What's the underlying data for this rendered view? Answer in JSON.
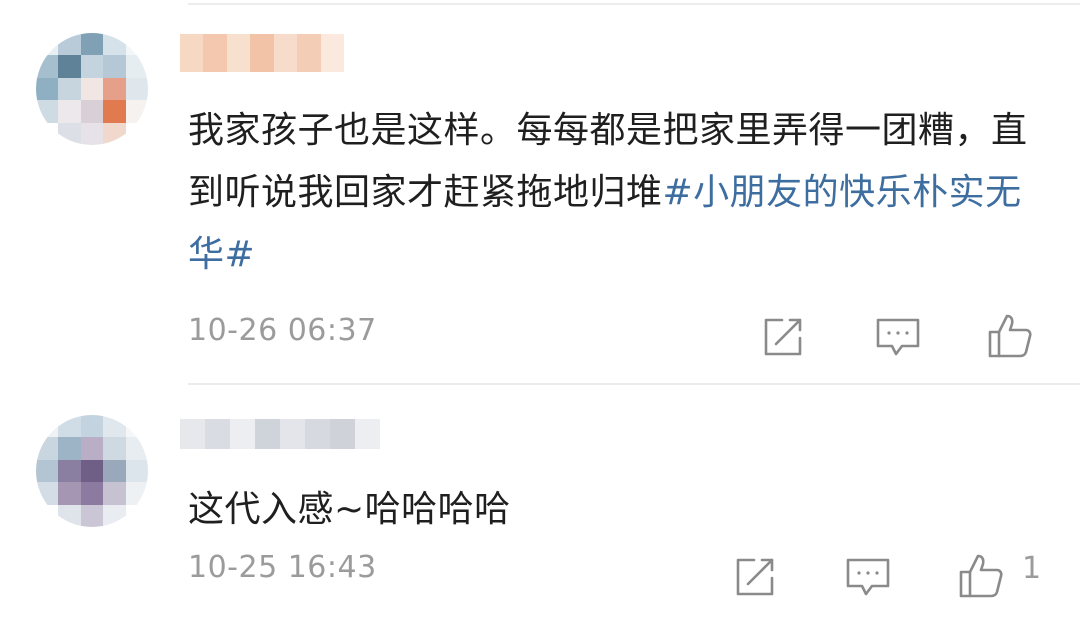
{
  "comments": [
    {
      "text_plain": "我家孩子也是这样。每每都是把家里弄得一团糟，直到听说我回家才赶紧拖地归堆",
      "topic": "#小朋友的快乐朴实无华#",
      "time": "10-26 06:37",
      "avatar_colors": [
        "#e9f0f4",
        "#b9cbd8",
        "#7fa0b5",
        "#d5e2ea",
        "#f3f6f8",
        "#a6bfcf",
        "#5f8299",
        "#c4d4de",
        "#b4c8d5",
        "#e6edf1",
        "#8fb0c3",
        "#c7d5de",
        "#f1e6e3",
        "#e6a08a",
        "#dfe7ec",
        "#cfdbe3",
        "#ece8ec",
        "#d9cfd6",
        "#e27a50",
        "#f5f2f0",
        "#ffffff",
        "#dcdfe6",
        "#e7e2e7",
        "#f1d8cd",
        "#ffffff"
      ],
      "username_colors": [
        "#f7d8c3",
        "#f3c8ae",
        "#f8e0cf",
        "#f2c3a6",
        "#f7dccb",
        "#f4cdb6",
        "#fbe9de"
      ],
      "icons": [
        "repost-icon",
        "comment-icon",
        "like-icon"
      ]
    },
    {
      "text_plain": "这代入感~哈哈哈哈",
      "time": "10-25 16:43",
      "like_count": "1",
      "avatar_colors": [
        "#eef2f5",
        "#d1dde6",
        "#c3d3df",
        "#e0e8ee",
        "#f4f6f8",
        "#c9d6e0",
        "#9db4c6",
        "#b9aec5",
        "#cfd9e2",
        "#e8edf1",
        "#b3c5d3",
        "#8a7fa0",
        "#6f5e86",
        "#9aa8bc",
        "#dde5ec",
        "#d4dde6",
        "#a597b3",
        "#8c7aa1",
        "#c6c2d2",
        "#eef1f4",
        "#ffffff",
        "#dfe3ea",
        "#cbc6d6",
        "#e9ecf1",
        "#ffffff"
      ],
      "username_colors": [
        "#e6e8ec",
        "#d9dce2",
        "#eceef1",
        "#cfd3da",
        "#e3e5ea",
        "#d6d9df",
        "#cfd2d8",
        "#eceef1"
      ]
    }
  ]
}
